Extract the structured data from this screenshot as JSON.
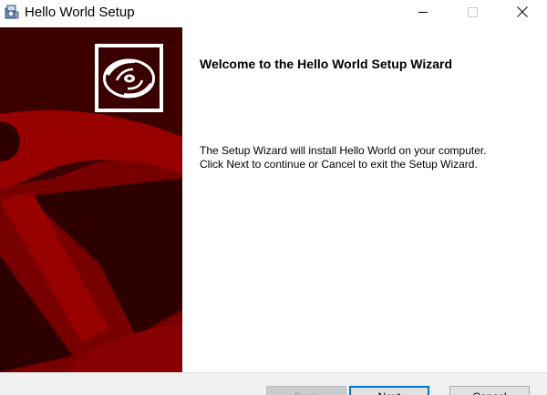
{
  "window": {
    "title": "Hello World Setup"
  },
  "icons": {
    "app": "installer-icon",
    "minimize": "minimize-icon",
    "maximize": "maximize-icon",
    "close": "close-icon",
    "disc": "disc-icon"
  },
  "colors": {
    "banner_red": "#7a0000",
    "banner_dark": "#3a0000",
    "accent": "#0078d7"
  },
  "content": {
    "heading": "Welcome to the Hello World Setup Wizard",
    "line1": "The Setup Wizard will install Hello World on your computer.",
    "line2": "Click Next to continue or Cancel to exit the Setup Wizard."
  },
  "buttons": {
    "back": "Back",
    "next": "Next",
    "cancel": "Cancel"
  }
}
